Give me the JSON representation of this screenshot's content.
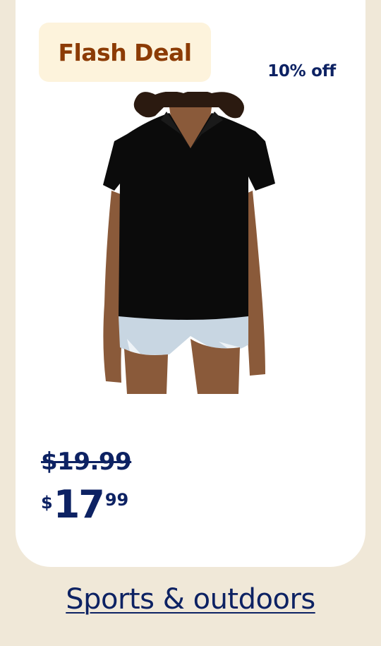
{
  "badge": {
    "label": "Flash Deal"
  },
  "discount": {
    "label": "10% off"
  },
  "product": {
    "image": "womens-black-polo-shirt"
  },
  "pricing": {
    "was_price": "$19.99",
    "currency_symbol": "$",
    "whole": "17",
    "cents": "99"
  },
  "category": {
    "label": "Sports & outdoors"
  },
  "colors": {
    "background": "#f0e8d8",
    "badge_bg": "#fdf3dc",
    "badge_text": "#8c3b05",
    "price_text": "#0d2263"
  }
}
